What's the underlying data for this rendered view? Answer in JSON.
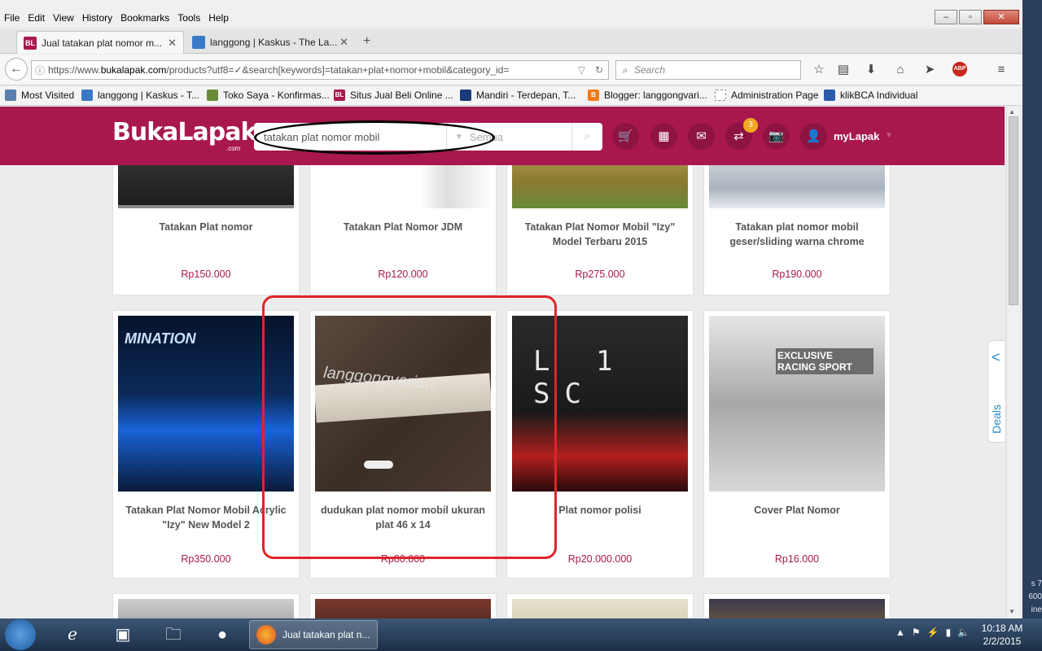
{
  "menubar": {
    "items": [
      "File",
      "Edit",
      "View",
      "History",
      "Bookmarks",
      "Tools",
      "Help"
    ]
  },
  "tabs": [
    {
      "label": "Jual tatakan plat nomor m...",
      "favicon": "BL"
    },
    {
      "label": "langgong | Kaskus - The La..."
    }
  ],
  "navbar": {
    "url_prefix": "https://www.",
    "url_domain": "bukalapak.com",
    "url_rest": "/products?utf8=✓&search[keywords]=tatakan+plat+nomor+mobil&category_id=",
    "search_placeholder": "Search"
  },
  "bookmarks": [
    "Most Visited",
    "langgong | Kaskus - T...",
    "Toko Saya - Konfirmas...",
    "Situs Jual Beli Online ...",
    "Mandiri - Terdepan, T...",
    "Blogger: langgongvari...",
    "Administration Page",
    "klikBCA Individual"
  ],
  "header": {
    "logo": "BukaLapak",
    "logo_sub": ".com",
    "search_query": "tatakan plat nomor mobil",
    "category": "Semua",
    "badge_count": "3",
    "mylapak": "myLapak"
  },
  "products_row1": [
    {
      "title": "Tatakan Plat nomor",
      "price": "Rp150.000"
    },
    {
      "title": "Tatakan Plat Nomor JDM",
      "price": "Rp120.000"
    },
    {
      "title": "Tatakan Plat Nomor Mobil \"Izy\" Model Terbaru 2015",
      "price": "Rp275.000"
    },
    {
      "title": "Tatakan plat nomor mobil geser/sliding warna chrome",
      "price": "Rp190.000"
    }
  ],
  "products_row2": [
    {
      "title": "Tatakan Plat Nomor Mobil Acrylic \"Izy\" New Model 2",
      "price": "Rp350.000",
      "img_text": "MINATION"
    },
    {
      "title": "dudukan plat nomor mobil ukuran plat 46 x 14",
      "price": "Rp80.000",
      "img_text": "langgongvarian"
    },
    {
      "title": "Plat nomor polisi",
      "price": "Rp20.000.000",
      "img_text": "L 1 SC"
    },
    {
      "title": "Cover Plat Nomor",
      "price": "Rp16.000",
      "img_text": "EXCLUSIVE RACING SPORT"
    }
  ],
  "deals_label": "Deals",
  "taskbar": {
    "firefox_label": "Jual tatakan plat n...",
    "time": "10:18 AM",
    "date": "2/2/2015"
  },
  "desktop_right": {
    "line1": "s 7",
    "line2": "600",
    "line3": "ine"
  }
}
